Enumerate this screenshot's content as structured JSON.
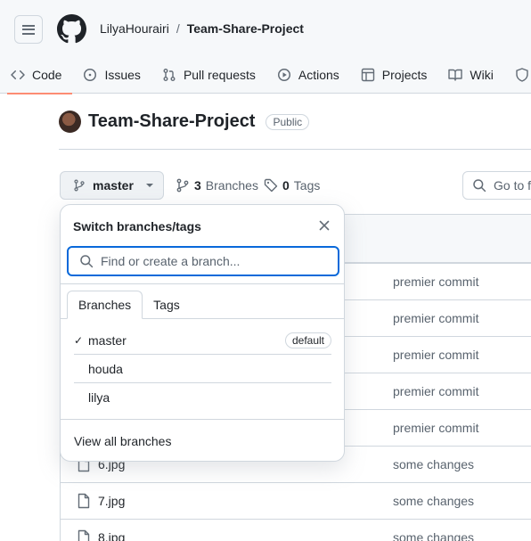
{
  "header": {
    "owner": "LilyaHourairi",
    "separator": "/",
    "repo": "Team-Share-Project"
  },
  "nav": {
    "items": [
      {
        "label": "Code",
        "icon": "code-icon"
      },
      {
        "label": "Issues",
        "icon": "issue-icon"
      },
      {
        "label": "Pull requests",
        "icon": "pull-request-icon"
      },
      {
        "label": "Actions",
        "icon": "play-icon"
      },
      {
        "label": "Projects",
        "icon": "table-icon"
      },
      {
        "label": "Wiki",
        "icon": "book-icon"
      }
    ]
  },
  "repo": {
    "name": "Team-Share-Project",
    "visibility": "Public"
  },
  "branch_bar": {
    "current_branch": "master",
    "branches_count": "3",
    "branches_label": "Branches",
    "tags_count": "0",
    "tags_label": "Tags",
    "goto_label": "Go to f"
  },
  "files": [
    {
      "name": "",
      "message": "premier commit"
    },
    {
      "name": "",
      "message": "premier commit"
    },
    {
      "name": "",
      "message": "premier commit"
    },
    {
      "name": "",
      "message": "premier commit"
    },
    {
      "name": "",
      "message": "premier commit"
    },
    {
      "name": "6.jpg",
      "message": "some changes"
    },
    {
      "name": "7.jpg",
      "message": "some changes"
    },
    {
      "name": "8.jpg",
      "message": "some changes"
    }
  ],
  "dropdown": {
    "title": "Switch branches/tags",
    "search_placeholder": "Find or create a branch...",
    "tabs": [
      "Branches",
      "Tags"
    ],
    "branches": [
      {
        "name": "master",
        "checked": "✓",
        "badge": "default"
      },
      {
        "name": "houda",
        "checked": "",
        "badge": ""
      },
      {
        "name": "lilya",
        "checked": "",
        "badge": ""
      }
    ],
    "view_all": "View all branches"
  },
  "colors": {
    "accent": "#0969da",
    "active_tab_underline": "#fd8c73",
    "border": "#d0d7de",
    "muted_text": "#59636e"
  }
}
